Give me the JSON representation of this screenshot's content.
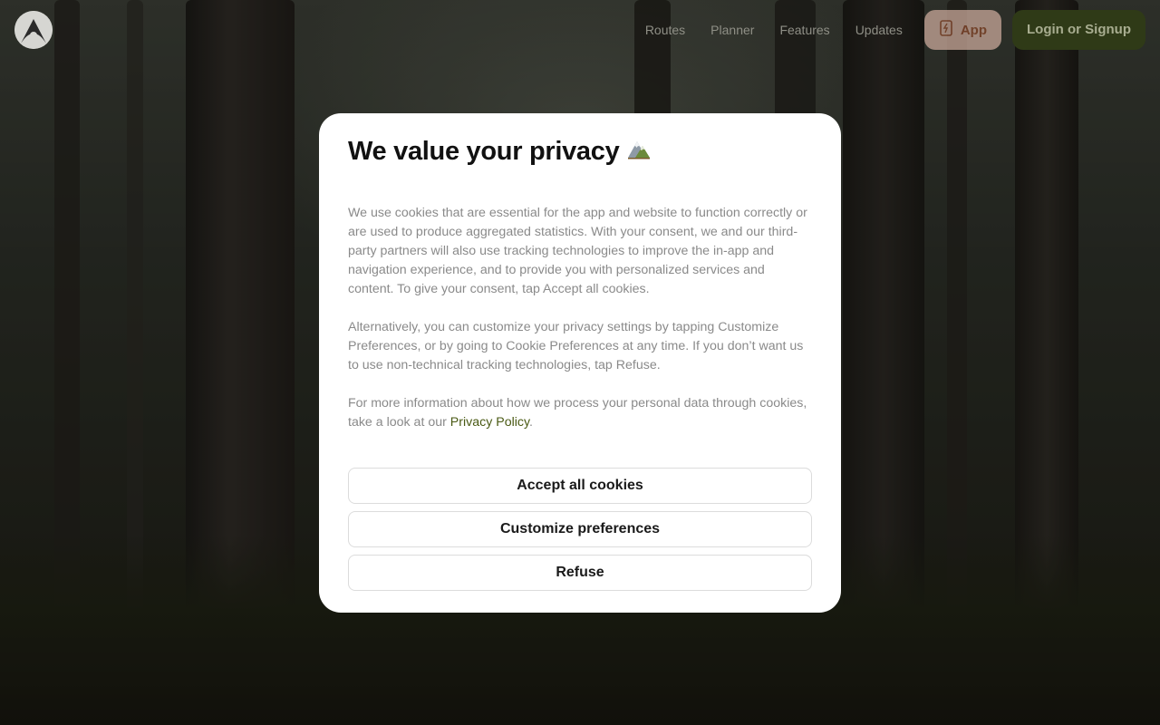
{
  "header": {
    "nav": [
      "Routes",
      "Planner",
      "Features",
      "Updates"
    ],
    "app_label": "App",
    "login_label": "Login or Signup"
  },
  "modal": {
    "title": "We value your privacy",
    "title_icon": "mountain-icon",
    "paragraphs": {
      "p1": "We use cookies that are essential for the app and website to function correctly or are used to produce aggregated statistics. With your consent, we and our third-party partners will also use tracking technologies to improve the in-app and navigation experience, and to provide you with personalized services and content. To give your consent, tap Accept all cookies.",
      "p2": "Alternatively, you can customize your privacy settings by tapping Customize Preferences, or by going to Cookie Preferences at any time. If you don’t want us to use non-technical tracking technologies, tap Refuse.",
      "p3_before": "For more information about how we process your personal data through cookies, take a look at our ",
      "p3_link": "Privacy Policy",
      "p3_after": "."
    },
    "buttons": {
      "accept": "Accept all cookies",
      "customize": "Customize preferences",
      "refuse": "Refuse"
    }
  },
  "colors": {
    "accent_green": "#4a5a14",
    "login_bg": "#2f3a17",
    "app_bg": "#c9a89a"
  }
}
